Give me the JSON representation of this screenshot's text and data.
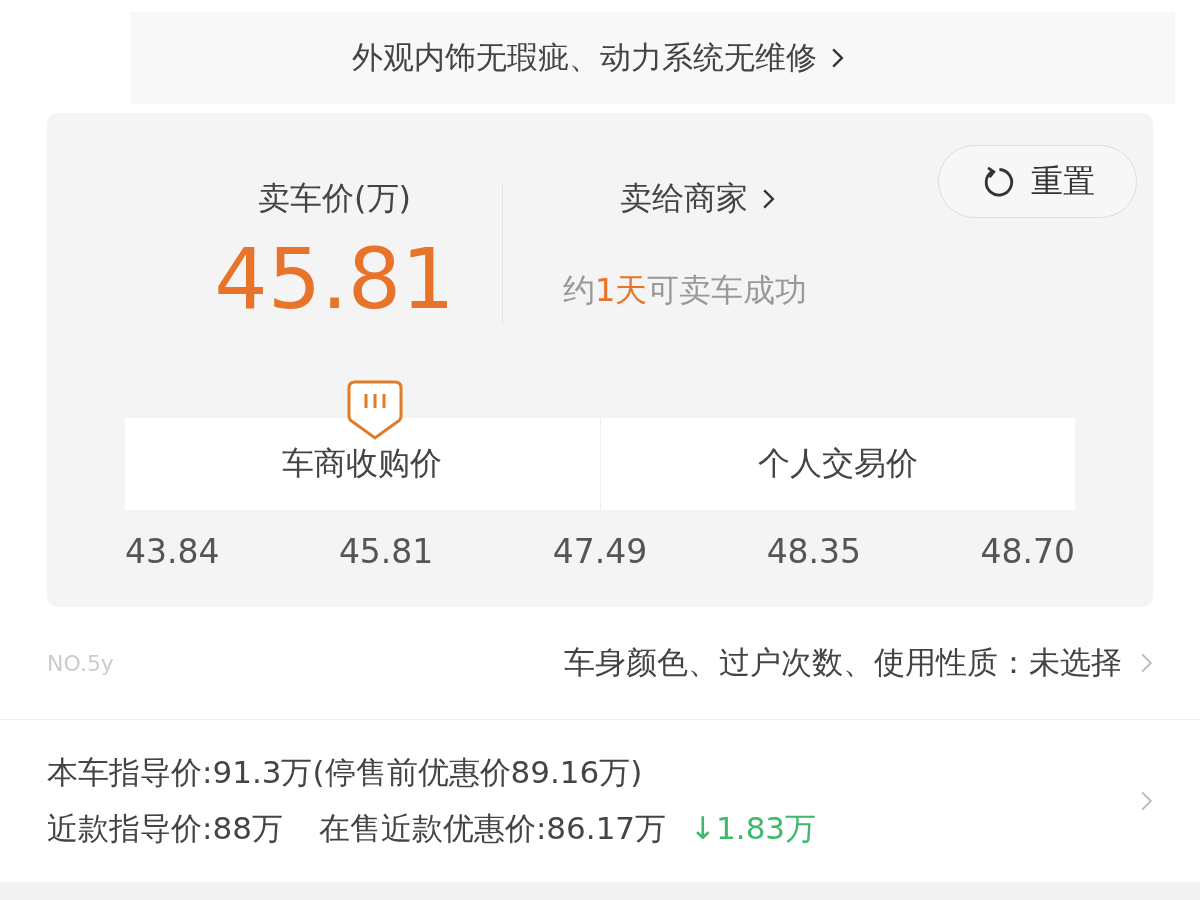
{
  "banner": {
    "text": "外观内饰无瑕疵、动力系统无维修"
  },
  "price": {
    "label": "卖车价(万)",
    "value": "45.81"
  },
  "dealer": {
    "label": "卖给商家",
    "note_prefix": "约",
    "note_highlight": "1天",
    "note_suffix": "可卖车成功"
  },
  "reset_button": {
    "label": "重置"
  },
  "segments": [
    {
      "label": "车商收购价"
    },
    {
      "label": "个人交易价"
    }
  ],
  "scale": [
    "43.84",
    "45.81",
    "47.49",
    "48.35",
    "48.70"
  ],
  "options": {
    "code": "NO.5y",
    "text": "车身颜色、过户次数、使用性质：未选择"
  },
  "guide": {
    "line1": "本车指导价:91.3万(停售前优惠价89.16万)",
    "recent": "近款指导价:88万",
    "on_sale": "在售近款优惠价:86.17万",
    "drop": "↓1.83万"
  }
}
